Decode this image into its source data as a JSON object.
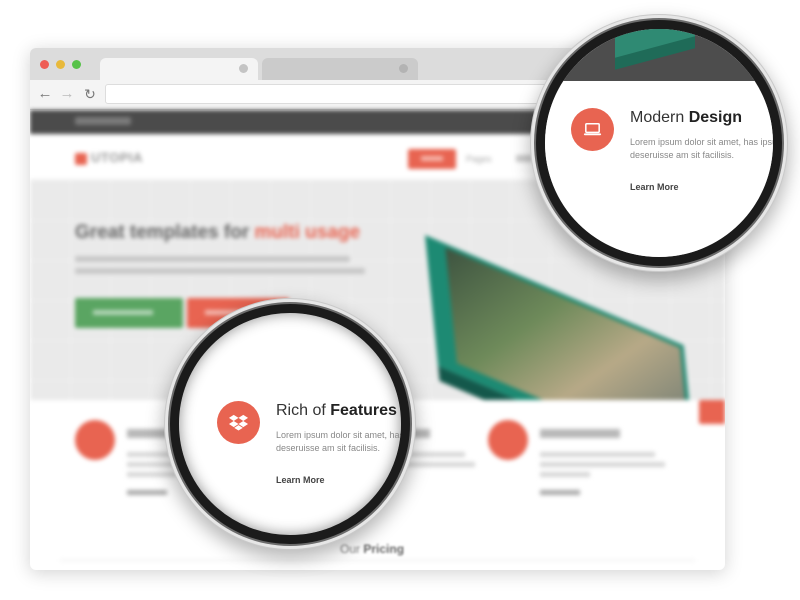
{
  "site": {
    "logo": "UTOPIA",
    "nav_pages": "Pages",
    "hero_title_plain": "Great templates for",
    "hero_title_accent": "multi usage",
    "pricing_plain": "Our",
    "pricing_bold": "Pricing"
  },
  "loupes": {
    "design": {
      "icon": "laptop-icon",
      "title_light": "Modern",
      "title_bold": "Design",
      "description": "Lorem ipsum dolor sit amet, has ipsum scaevola deseruisse am sit facilisis.",
      "link": "Learn More"
    },
    "features": {
      "icon": "dropbox-icon",
      "title_light": "Rich of",
      "title_bold": "Features",
      "description": "Lorem ipsum dolor sit amet, has ipsum scaevola deseruisse am sit facilisis.",
      "link": "Learn More"
    }
  },
  "colors": {
    "accent": "#e86451",
    "green": "#5aa562",
    "laptop": "#1d8a73",
    "dark_bar": "#4b4b4b"
  }
}
